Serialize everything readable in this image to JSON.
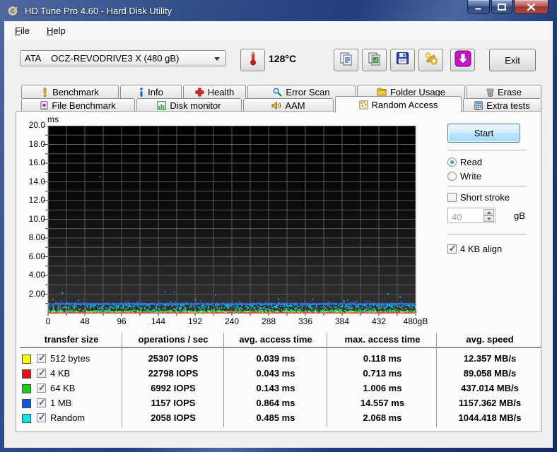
{
  "window": {
    "title": "HD Tune Pro 4.60 - Hard Disk Utility"
  },
  "menu": {
    "items": [
      {
        "label": "File"
      },
      {
        "label": "Help"
      }
    ]
  },
  "toolbar": {
    "drive_select": "ATA    OCZ-REVODRIVE3 X (480 gB)",
    "temperature": "128°C",
    "exit_label": "Exit",
    "buttons": [
      "thermometer-icon",
      "copy-text-icon",
      "copy-image-icon",
      "save-icon",
      "options-icon",
      "download-icon"
    ]
  },
  "tabs": {
    "selected": "Random Access",
    "row1": [
      {
        "label": "Benchmark",
        "icon": "benchmark-icon"
      },
      {
        "label": "Info",
        "icon": "info-icon"
      },
      {
        "label": "Health",
        "icon": "health-icon"
      },
      {
        "label": "Error Scan",
        "icon": "error-scan-icon"
      },
      {
        "label": "Folder Usage",
        "icon": "folder-usage-icon"
      },
      {
        "label": "Erase",
        "icon": "erase-icon"
      }
    ],
    "row2": [
      {
        "label": "File Benchmark",
        "icon": "file-benchmark-icon"
      },
      {
        "label": "Disk monitor",
        "icon": "disk-monitor-icon"
      },
      {
        "label": "AAM",
        "icon": "aam-icon"
      },
      {
        "label": "Random Access",
        "icon": "random-access-icon"
      },
      {
        "label": "Extra tests",
        "icon": "extra-tests-icon"
      }
    ]
  },
  "controls_panel": {
    "start_label": "Start",
    "read_label": "Read",
    "read_selected": true,
    "write_label": "Write",
    "write_selected": false,
    "short_stroke_label": "Short stroke",
    "short_stroke_checked": false,
    "short_stroke_value": "40",
    "short_stroke_unit": "gB",
    "align_label": "4 KB align",
    "align_checked": true
  },
  "chart_data": {
    "type": "scatter",
    "title": "Random access time vs disk position",
    "ylabel": "ms",
    "xlabel": "gB",
    "xlim": [
      0,
      480
    ],
    "ylim": [
      0,
      20
    ],
    "grid": {
      "x_step_gb": 24,
      "y_step_ms": 1,
      "on": true
    },
    "y_ticks": [
      {
        "label": "20.0",
        "value": 20
      },
      {
        "label": "18.0",
        "value": 18
      },
      {
        "label": "16.0",
        "value": 16
      },
      {
        "label": "14.0",
        "value": 14
      },
      {
        "label": "12.0",
        "value": 12
      },
      {
        "label": "10.0",
        "value": 10
      },
      {
        "label": "8.00",
        "value": 8
      },
      {
        "label": "6.00",
        "value": 6
      },
      {
        "label": "4.00",
        "value": 4
      },
      {
        "label": "2.00",
        "value": 2
      }
    ],
    "x_ticks": [
      {
        "label": "0",
        "value": 0
      },
      {
        "label": "48",
        "value": 48
      },
      {
        "label": "96",
        "value": 96
      },
      {
        "label": "144",
        "value": 144
      },
      {
        "label": "192",
        "value": 192
      },
      {
        "label": "240",
        "value": 240
      },
      {
        "label": "288",
        "value": 288
      },
      {
        "label": "336",
        "value": 336
      },
      {
        "label": "384",
        "value": 384
      },
      {
        "label": "432",
        "value": 432
      },
      {
        "label": "480gB",
        "value": 480
      }
    ],
    "draw_order": [
      "Random",
      "64 KB",
      "512 bytes",
      "1 MB",
      "4 KB"
    ],
    "series": [
      {
        "name": "512 bytes",
        "color": "#f2f200",
        "avg_ms": 0.039,
        "max_ms": 0.118,
        "bands": [
          [
            0.03,
            0.2,
            550
          ]
        ]
      },
      {
        "name": "4 KB",
        "color": "#e81010",
        "avg_ms": 0.043,
        "max_ms": 0.713,
        "bands": [
          [
            0.04,
            0.14,
            250
          ]
        ],
        "line_ms": 0.05
      },
      {
        "name": "64 KB",
        "color": "#30e030",
        "avg_ms": 0.143,
        "max_ms": 1.006,
        "bands": [
          [
            0.07,
            0.32,
            500
          ]
        ]
      },
      {
        "name": "1 MB",
        "color": "#2e7dff",
        "avg_ms": 0.864,
        "max_ms": 14.557,
        "bands": [
          [
            0.93,
            1.08,
            850
          ],
          [
            0.8,
            1.3,
            70
          ]
        ]
      },
      {
        "name": "Random",
        "color": "#00d8e8",
        "avg_ms": 0.485,
        "max_ms": 2.068,
        "bands": [
          [
            0.15,
            0.95,
            680
          ],
          [
            0.95,
            1.6,
            20
          ]
        ]
      }
    ],
    "outliers": [
      {
        "series": "1 MB",
        "x_gb": 67,
        "y_ms": 14.6
      },
      {
        "series": "1 MB",
        "x_gb": 152,
        "y_ms": 2.35
      },
      {
        "series": "1 MB",
        "x_gb": 164,
        "y_ms": 2.3
      },
      {
        "series": "1 MB",
        "x_gb": 218,
        "y_ms": 1.95
      },
      {
        "series": "1 MB",
        "x_gb": 345,
        "y_ms": 1.5
      },
      {
        "series": "Random",
        "x_gb": 18,
        "y_ms": 2.2
      },
      {
        "series": "Random",
        "x_gb": 300,
        "y_ms": 1.55
      },
      {
        "series": "Random",
        "x_gb": 443,
        "y_ms": 2.1
      },
      {
        "series": "Random",
        "x_gb": 459,
        "y_ms": 1.75
      }
    ]
  },
  "table": {
    "headers": [
      "transfer size",
      "operations / sec",
      "avg. access time",
      "max. access time",
      "avg. speed"
    ],
    "rows": [
      {
        "color": "#f8f800",
        "checked": true,
        "size": "512 bytes",
        "ops": "25307 IOPS",
        "avg": "0.039 ms",
        "max": "0.118 ms",
        "speed": "12.357 MB/s"
      },
      {
        "color": "#e81010",
        "checked": true,
        "size": "4 KB",
        "ops": "22798 IOPS",
        "avg": "0.043 ms",
        "max": "0.713 ms",
        "speed": "89.058 MB/s"
      },
      {
        "color": "#18d018",
        "checked": true,
        "size": "64 KB",
        "ops": "6992 IOPS",
        "avg": "0.143 ms",
        "max": "1.006 ms",
        "speed": "437.014 MB/s"
      },
      {
        "color": "#1258d8",
        "checked": true,
        "size": "1 MB",
        "ops": "1157 IOPS",
        "avg": "0.864 ms",
        "max": "14.557 ms",
        "speed": "1157.362 MB/s"
      },
      {
        "color": "#00e8e8",
        "checked": true,
        "size": "Random",
        "ops": "2058 IOPS",
        "avg": "0.485 ms",
        "max": "2.068 ms",
        "speed": "1044.418 MB/s"
      }
    ]
  }
}
